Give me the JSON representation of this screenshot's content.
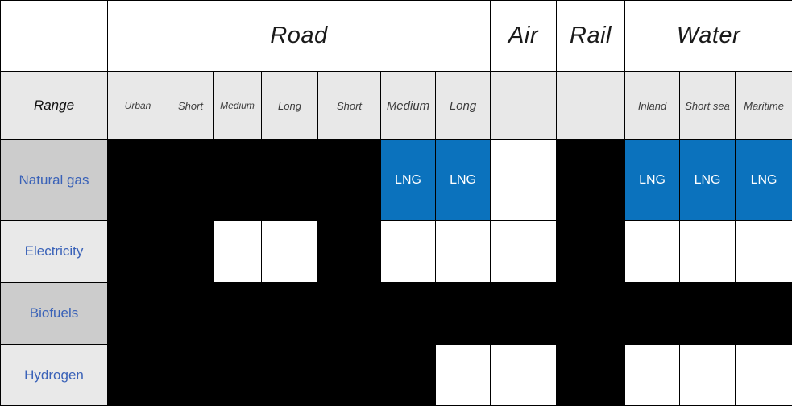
{
  "table": {
    "corner_label": "",
    "range_row_label": "Range",
    "groups": [
      {
        "name": "",
        "colspan": 1
      },
      {
        "name": "Road",
        "colspan": 7
      },
      {
        "name": "Air",
        "colspan": 1
      },
      {
        "name": "Rail",
        "colspan": 1
      },
      {
        "name": "Water",
        "colspan": 3
      }
    ],
    "columns": [
      {
        "label": "Urban",
        "group": "Road",
        "size": "sm",
        "group_start": true,
        "group_end": false
      },
      {
        "label": "Short",
        "group": "Road",
        "size": "md",
        "group_start": false,
        "group_end": false
      },
      {
        "label": "Medium",
        "group": "Road",
        "size": "sm",
        "group_start": false,
        "group_end": false
      },
      {
        "label": "Long",
        "group": "Road",
        "size": "md",
        "group_start": false,
        "group_end": false
      },
      {
        "label": "Short",
        "group": "Road",
        "size": "md",
        "group_start": false,
        "group_end": false
      },
      {
        "label": "Medium",
        "group": "Road",
        "size": "lg",
        "group_start": false,
        "group_end": false
      },
      {
        "label": "Long",
        "group": "Road",
        "size": "lg",
        "group_start": false,
        "group_end": true
      },
      {
        "label": "",
        "group": "Air",
        "size": "md",
        "group_start": true,
        "group_end": true
      },
      {
        "label": "",
        "group": "Rail",
        "size": "md",
        "group_start": true,
        "group_end": true
      },
      {
        "label": "Inland",
        "group": "Water",
        "size": "md",
        "group_start": true,
        "group_end": false
      },
      {
        "label": "Short sea",
        "group": "Water",
        "size": "md",
        "group_start": false,
        "group_end": false
      },
      {
        "label": "Maritime",
        "group": "Water",
        "size": "md",
        "group_start": false,
        "group_end": true
      }
    ],
    "rows": [
      {
        "label": "Natural gas",
        "shade": "dark",
        "cells": [
          {
            "state": "black",
            "label": ""
          },
          {
            "state": "black",
            "label": ""
          },
          {
            "state": "black",
            "label": ""
          },
          {
            "state": "black",
            "label": ""
          },
          {
            "state": "black",
            "label": ""
          },
          {
            "state": "blue",
            "label": "LNG"
          },
          {
            "state": "blue",
            "label": "LNG"
          },
          {
            "state": "white",
            "label": ""
          },
          {
            "state": "black",
            "label": ""
          },
          {
            "state": "blue",
            "label": "LNG"
          },
          {
            "state": "blue",
            "label": "LNG"
          },
          {
            "state": "blue",
            "label": "LNG"
          }
        ]
      },
      {
        "label": "Electricity",
        "shade": "light",
        "cells": [
          {
            "state": "black",
            "label": ""
          },
          {
            "state": "black",
            "label": ""
          },
          {
            "state": "white",
            "label": ""
          },
          {
            "state": "white",
            "label": ""
          },
          {
            "state": "black",
            "label": ""
          },
          {
            "state": "white",
            "label": ""
          },
          {
            "state": "white",
            "label": ""
          },
          {
            "state": "white",
            "label": ""
          },
          {
            "state": "black",
            "label": ""
          },
          {
            "state": "white",
            "label": ""
          },
          {
            "state": "white",
            "label": ""
          },
          {
            "state": "white",
            "label": ""
          }
        ]
      },
      {
        "label": "Biofuels",
        "shade": "dark",
        "cells": [
          {
            "state": "black",
            "label": ""
          },
          {
            "state": "black",
            "label": ""
          },
          {
            "state": "black",
            "label": ""
          },
          {
            "state": "black",
            "label": ""
          },
          {
            "state": "black",
            "label": ""
          },
          {
            "state": "black",
            "label": ""
          },
          {
            "state": "black",
            "label": ""
          },
          {
            "state": "black",
            "label": ""
          },
          {
            "state": "black",
            "label": ""
          },
          {
            "state": "black",
            "label": ""
          },
          {
            "state": "black",
            "label": ""
          },
          {
            "state": "black",
            "label": ""
          }
        ]
      },
      {
        "label": "Hydrogen",
        "shade": "light",
        "cells": [
          {
            "state": "black",
            "label": ""
          },
          {
            "state": "black",
            "label": ""
          },
          {
            "state": "black",
            "label": ""
          },
          {
            "state": "black",
            "label": ""
          },
          {
            "state": "black",
            "label": ""
          },
          {
            "state": "black",
            "label": ""
          },
          {
            "state": "white",
            "label": ""
          },
          {
            "state": "white",
            "label": ""
          },
          {
            "state": "black",
            "label": ""
          },
          {
            "state": "white",
            "label": ""
          },
          {
            "state": "white",
            "label": ""
          },
          {
            "state": "white",
            "label": ""
          }
        ]
      }
    ]
  },
  "colors": {
    "lng_blue": "#0b72bd",
    "filled_black": "#000000",
    "empty_white": "#ffffff",
    "row_label_text": "#3a62b8",
    "header_bg": "#e8e8e8",
    "row_shade_dark": "#cccccc",
    "row_shade_light": "#e9e9e9"
  }
}
